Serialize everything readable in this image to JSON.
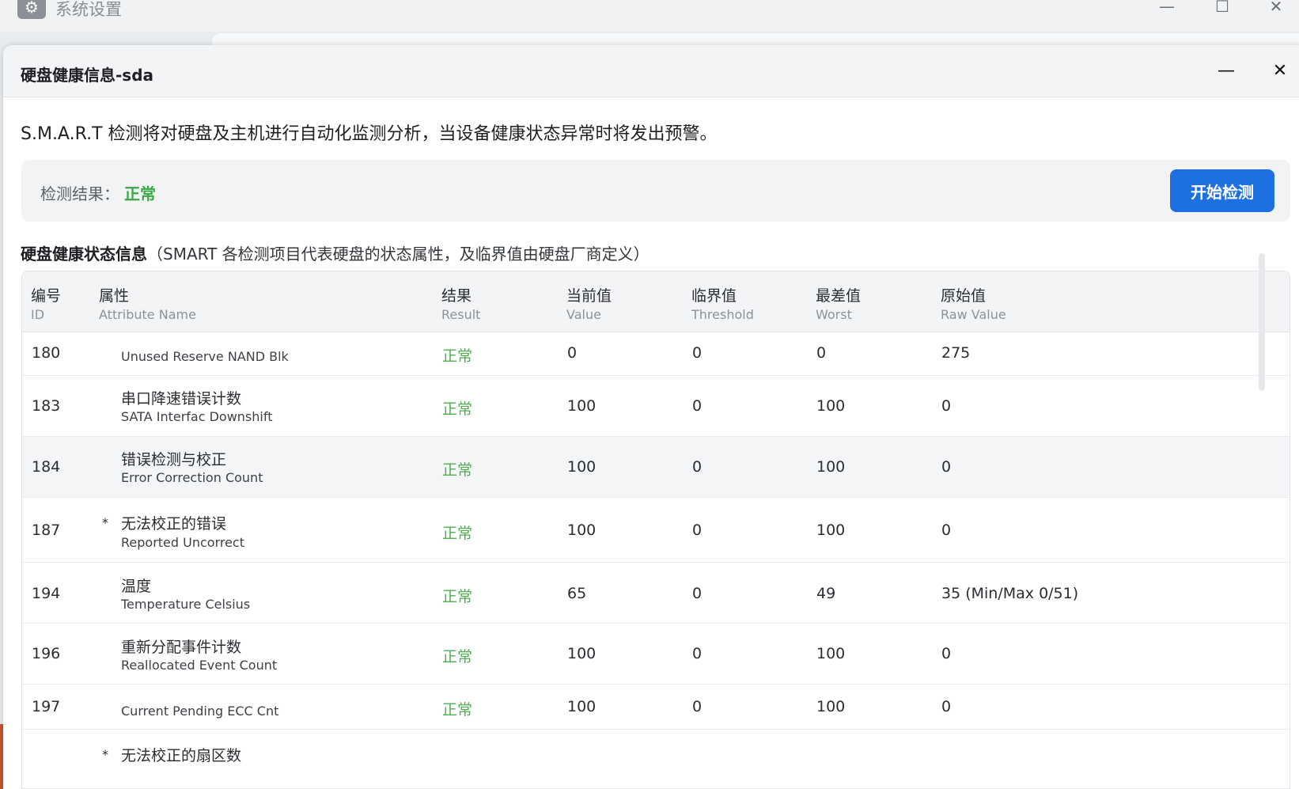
{
  "window": {
    "title": "系统设置",
    "icon": "gear-icon",
    "controls": [
      "minimize",
      "maximize",
      "close"
    ]
  },
  "dialog": {
    "title": "硬盘健康信息-sda",
    "minimize_symbol": "—",
    "close_symbol": "✕"
  },
  "description": "S.M.A.R.T 检测将对硬盘及主机进行自动化监测分析，当设备健康状态异常时将发出预警。",
  "detection": {
    "label": "检测结果：",
    "value": "正常",
    "value_color": "#3aa845",
    "button_label": "开始检测",
    "button_color": "#1e6fe0"
  },
  "section": {
    "title": "硬盘健康状态信息",
    "note": "（SMART 各检测项目代表硬盘的状态属性，及临界值由硬盘厂商定义）"
  },
  "table": {
    "columns": [
      {
        "cn": "编号",
        "en": "ID"
      },
      {
        "cn": "属性",
        "en": "Attribute Name"
      },
      {
        "cn": "结果",
        "en": "Result"
      },
      {
        "cn": "当前值",
        "en": "Value"
      },
      {
        "cn": "临界值",
        "en": "Threshold"
      },
      {
        "cn": "最差值",
        "en": "Worst"
      },
      {
        "cn": "原始值",
        "en": "Raw Value"
      }
    ],
    "rows": [
      {
        "id": "180",
        "cn": "",
        "en": "Unused Reserve NAND Blk",
        "star": "",
        "result": "正常",
        "value": "0",
        "threshold": "0",
        "worst": "0",
        "raw": "275"
      },
      {
        "id": "183",
        "cn": "串口降速错误计数",
        "en": "SATA Interfac Downshift",
        "star": "",
        "result": "正常",
        "value": "100",
        "threshold": "0",
        "worst": "100",
        "raw": "0"
      },
      {
        "id": "184",
        "cn": "错误检测与校正",
        "en": "Error Correction Count",
        "star": "",
        "result": "正常",
        "value": "100",
        "threshold": "0",
        "worst": "100",
        "raw": "0"
      },
      {
        "id": "187",
        "cn": "无法校正的错误",
        "en": "Reported Uncorrect",
        "star": "*",
        "result": "正常",
        "value": "100",
        "threshold": "0",
        "worst": "100",
        "raw": "0"
      },
      {
        "id": "194",
        "cn": "温度",
        "en": "Temperature Celsius",
        "star": "",
        "result": "正常",
        "value": "65",
        "threshold": "0",
        "worst": "49",
        "raw": "35 (Min/Max 0/51)"
      },
      {
        "id": "196",
        "cn": "重新分配事件计数",
        "en": "Reallocated Event Count",
        "star": "",
        "result": "正常",
        "value": "100",
        "threshold": "0",
        "worst": "100",
        "raw": "0"
      },
      {
        "id": "197",
        "cn": "",
        "en": "Current Pending ECC Cnt",
        "star": "",
        "result": "正常",
        "value": "100",
        "threshold": "0",
        "worst": "100",
        "raw": "0"
      },
      {
        "id": "",
        "cn": "无法校正的扇区数",
        "en": "",
        "star": "*",
        "result": "",
        "value": "",
        "threshold": "",
        "worst": "",
        "raw": ""
      }
    ]
  }
}
